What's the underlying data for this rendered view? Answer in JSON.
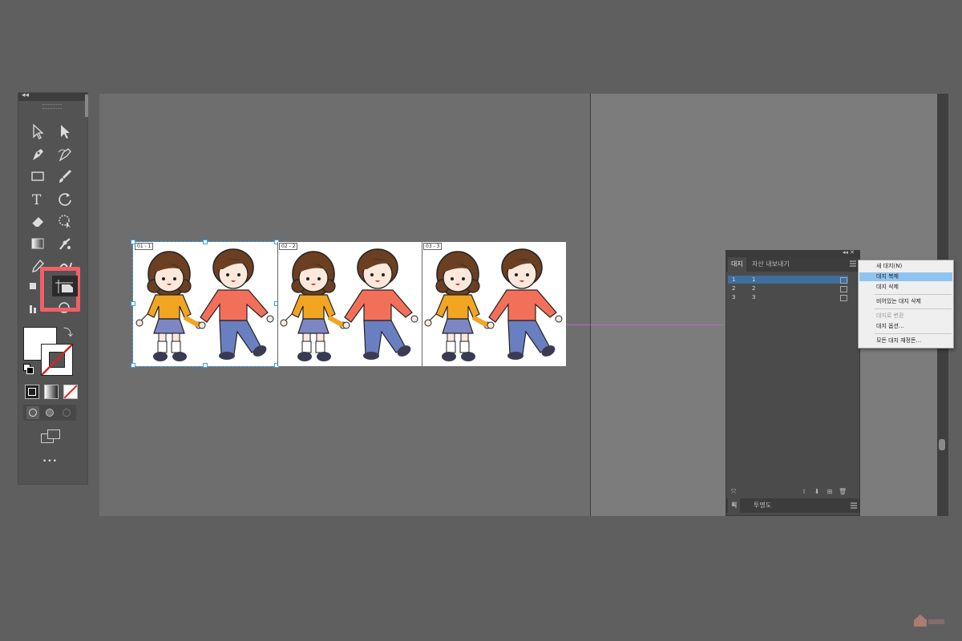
{
  "toolbar": {
    "collapse_glyph": "◂◂",
    "more_glyph": "•••",
    "tools": [
      "selection-tool",
      "direct-selection-tool",
      "pen-tool",
      "curvature-tool",
      "rectangle-tool",
      "paintbrush-tool",
      "type-tool",
      "rotate-tool",
      "eraser-tool",
      "free-transform-tool",
      "gradient-tool",
      "puppet-warp-tool",
      "eyedropper-tool",
      "blend-tool",
      "shape-builder-tool",
      "artboard-tool",
      "graph-tool",
      "zoom-tool"
    ]
  },
  "artboards": [
    {
      "label": "01 - 1"
    },
    {
      "label": "02 - 2"
    },
    {
      "label": "03 - 3"
    }
  ],
  "panel": {
    "tabs": [
      "대지",
      "자산 내보내기"
    ],
    "rows": [
      {
        "num": "1",
        "name": "1"
      },
      {
        "num": "2",
        "name": "2"
      },
      {
        "num": "3",
        "name": "3"
      }
    ],
    "bottom_tabs": [
      "획",
      "투명도"
    ],
    "header_icons": "◂◂ ✕"
  },
  "context_menu": {
    "items": [
      {
        "label": "새 대지(N)",
        "state": "normal"
      },
      {
        "label": "대지 복제",
        "state": "highlighted"
      },
      {
        "label": "대지 삭제",
        "state": "normal"
      },
      {
        "label": "비어있는 대지 삭제",
        "state": "normal"
      },
      {
        "label": "대지로 변환",
        "state": "disabled"
      },
      {
        "label": "대지 옵션...",
        "state": "normal"
      },
      {
        "label": "모든 대지 재정돈...",
        "state": "normal"
      }
    ]
  },
  "colors": {
    "highlight_border": "#f06068",
    "selection_blue": "#3aa0e8",
    "menu_highlight": "#90c4f0",
    "girl_shirt": "#f2a521",
    "boy_shirt": "#f2705a",
    "skirt": "#7d86c4",
    "pants": "#6a7fbf",
    "hair": "#6b3f22"
  }
}
